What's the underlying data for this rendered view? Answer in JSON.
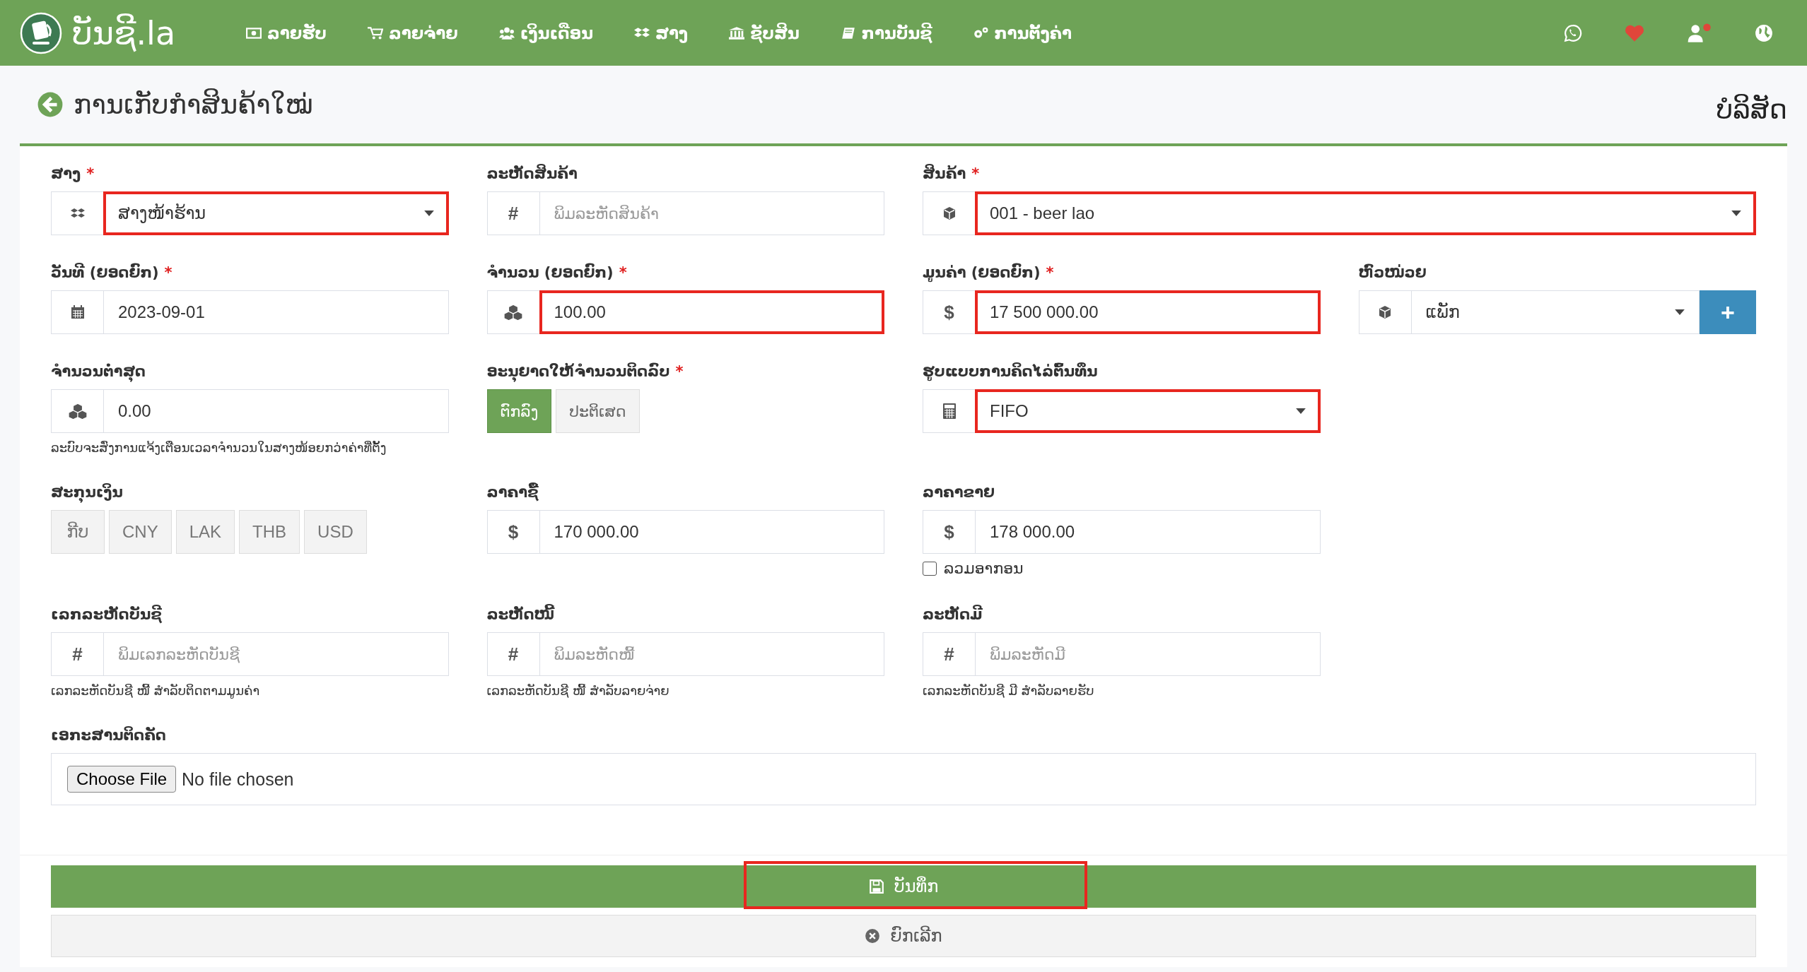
{
  "navbar": {
    "brand": "ບັນຊີ.la",
    "items": [
      {
        "label": "ລາຍຮັບ"
      },
      {
        "label": "ລາຍຈ່າຍ"
      },
      {
        "label": "ເງິນເດືອນ"
      },
      {
        "label": "ສາງ"
      },
      {
        "label": "ຊັບສິນ"
      },
      {
        "label": "ການບັນຊີ"
      },
      {
        "label": "ການຕັ້ງຄ່າ"
      }
    ]
  },
  "page": {
    "title": "ການເກັບກຳສິນຄ້າໃໝ່",
    "company": "ບໍລິສັດ"
  },
  "form": {
    "rows": [
      [
        {
          "kind": "select",
          "label": "ສາງ",
          "required_mark": "*",
          "value": "ສາງໜ້າຮ້ານ",
          "highlighted": true
        },
        {
          "kind": "input",
          "label": "ລະຫັດສິນຄ້າ",
          "addon": "#",
          "placeholder": "ພິມລະຫັດສິນຄ້າ",
          "highlighted": false
        },
        {
          "kind": "wide-select",
          "label": "ສິນຄ້າ",
          "required_mark": "*",
          "value": "001 - beer lao",
          "highlighted": true
        }
      ],
      [
        {
          "kind": "input",
          "label": "ວັນທີ (ຍອດຍົກ)",
          "required_mark": "*",
          "value": "2023-09-01",
          "highlighted": false
        },
        {
          "kind": "input",
          "label": "ຈຳນວນ (ຍອດຍົກ)",
          "required_mark": "*",
          "value": "100.00",
          "highlighted": true
        },
        {
          "kind": "input",
          "label": "ມູນຄ່າ (ຍອດຍົກ)",
          "required_mark": "*",
          "addon": "$",
          "value": "17 500 000.00",
          "highlighted": true
        },
        {
          "kind": "select-add",
          "label": "ຫົວໜ່ວຍ",
          "value": "ແພັກ",
          "button": "+",
          "highlighted": false
        }
      ],
      [
        {
          "kind": "input",
          "label": "ຈຳນວນຕ່ຳສຸດ",
          "value": "0.00",
          "help": "ລະບົບຈະສົ່ງການແຈ້ງເຕືອນເວລາຈຳນວນໃນສາງໜ້ອຍກວ່າຄ່າທີ່ຕັ້ງ",
          "highlighted": false
        },
        {
          "kind": "toggle",
          "label": "ອະນຸຍາດໃຫ້ຈຳນວນຕິດລົບ",
          "required_mark": "*",
          "options": [
            {
              "label": "ຕົກລົງ",
              "selected": true
            },
            {
              "label": "ປະຕິເສດ",
              "selected": false
            }
          ]
        },
        {
          "kind": "select",
          "label": "ຮູບແບບການຄິດໄລ່ຕົ້ນທຶນ",
          "value": "FIFO",
          "highlighted": true
        }
      ],
      [
        {
          "kind": "buttons",
          "label": "ສະກຸນເງິນ",
          "options": [
            {
              "label": "ກີບ"
            },
            {
              "label": "CNY"
            },
            {
              "label": "LAK"
            },
            {
              "label": "THB"
            },
            {
              "label": "USD"
            }
          ]
        },
        {
          "kind": "input",
          "label": "ລາຄາຊື້",
          "addon": "$",
          "value": "170 000.00",
          "highlighted": false
        },
        {
          "kind": "input",
          "label": "ລາຄາຂາຍ",
          "addon": "$",
          "value": "178 000.00",
          "highlighted": false,
          "checkbox": {
            "label": "ລວມອາກອນ",
            "checked": false
          }
        }
      ],
      [
        {
          "kind": "input",
          "label": "ເລກລະຫັດບັນຊີ",
          "addon": "#",
          "placeholder": "ພິມເລກລະຫັດບັນຊີ",
          "help": "ເລກລະຫັດບັນຊີ ໜີ້ ສຳລັບຕິດຕາມມູນຄ່າ",
          "highlighted": false
        },
        {
          "kind": "input",
          "label": "ລະຫັດໜີ້",
          "addon": "#",
          "placeholder": "ພິມລະຫັດໜີ້",
          "help": "ເລກລະຫັດບັນຊີ ໜີ້ ສຳລັບລາຍຈ່າຍ",
          "highlighted": false
        },
        {
          "kind": "input",
          "label": "ລະຫັດມີ",
          "addon": "#",
          "placeholder": "ພິມລະຫັດມີ",
          "help": "ເລກລະຫັດບັນຊີ ມີ ສຳລັບລາຍຮັບ",
          "highlighted": false
        }
      ]
    ],
    "attachment": {
      "label": "ເອກະສານຕິດຄັດ",
      "button": "Choose File",
      "status": "No file chosen"
    }
  },
  "actions": {
    "save": {
      "label": "ບັນທຶກ",
      "highlighted": true
    },
    "cancel": {
      "label": "ຍົກເລີກ"
    }
  }
}
